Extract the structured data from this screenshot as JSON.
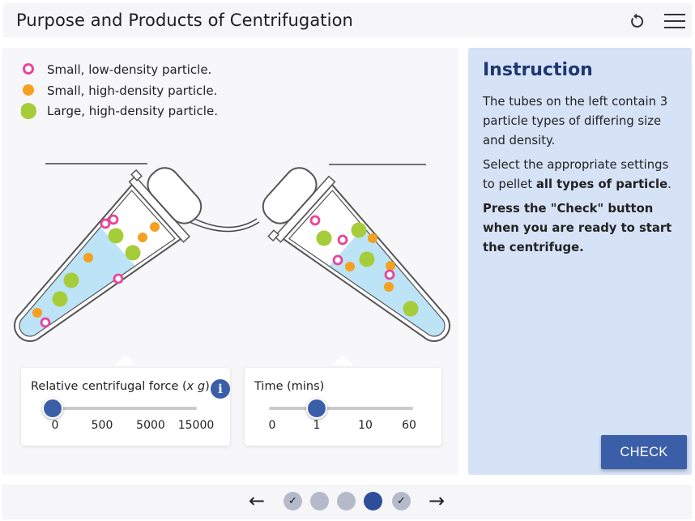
{
  "header": {
    "title": "Purpose and Products of Centrifugation",
    "reset_icon": "reset-icon",
    "menu_icon": "hamburger-menu-icon"
  },
  "legend": [
    {
      "label": "Small, low-density particle.",
      "kind": "ring",
      "color": "#e8459a"
    },
    {
      "label": "Small, high-density particle.",
      "kind": "dot",
      "color": "#f5a020"
    },
    {
      "label": "Large, high-density particle.",
      "kind": "dot",
      "color": "#a6cc3a"
    }
  ],
  "rcf": {
    "label_pre": "Relative centrifugal force (",
    "label_x": "x",
    "label_g": "g",
    "label_post": ")",
    "ticks": [
      "0",
      "500",
      "5000",
      "15000"
    ],
    "selected": "0",
    "info_glyph": "i"
  },
  "time": {
    "label": "Time (mins)",
    "ticks": [
      "0",
      "1",
      "10",
      "60"
    ],
    "selected": "1"
  },
  "instruction": {
    "title": "Instruction",
    "p1": "The tubes on the left contain 3 particle types of differing size and density.",
    "p2_pre": "Select the appropriate settings to pellet ",
    "p2_bold": "all types of particle",
    "p2_post": ".",
    "p3": "Press the \"Check\" button when you are ready to start the centrifuge."
  },
  "check_label": "CHECK",
  "footer": {
    "prev": "←",
    "next": "→",
    "steps": [
      {
        "state": "done",
        "glyph": "✓"
      },
      {
        "state": "pending",
        "glyph": ""
      },
      {
        "state": "pending",
        "glyph": ""
      },
      {
        "state": "current",
        "glyph": ""
      },
      {
        "state": "done",
        "glyph": "✓"
      }
    ]
  },
  "colors": {
    "accent": "#3b5ea8",
    "panel_blue": "#d6e3f7",
    "liquid": "#bde3f6",
    "ring_particle": "#e8459a",
    "small_dense": "#f5a020",
    "large_dense": "#a6cc3a"
  }
}
